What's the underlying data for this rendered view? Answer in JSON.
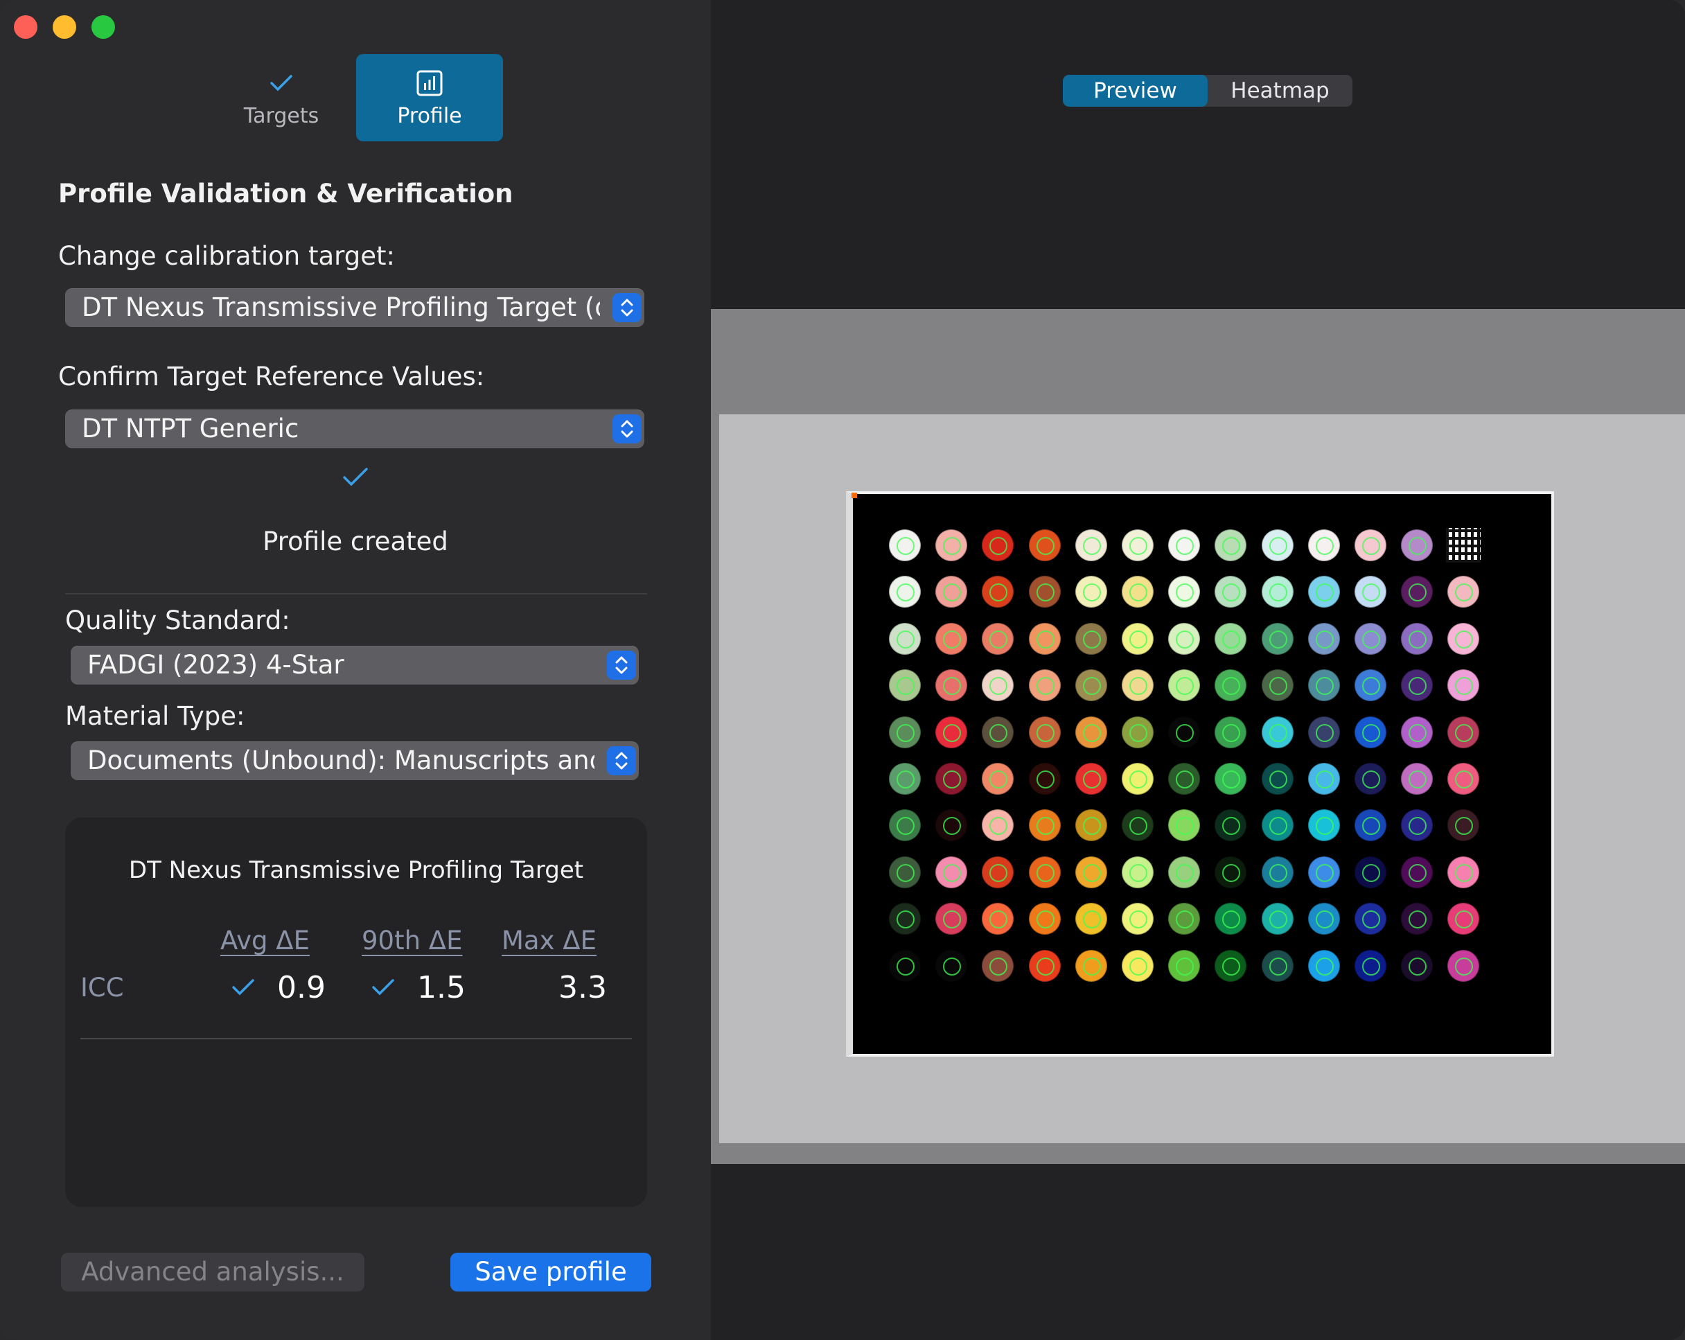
{
  "tabs": [
    {
      "label": "Targets",
      "icon": "checkmark-icon",
      "active": false
    },
    {
      "label": "Profile",
      "icon": "chart-icon",
      "active": true
    }
  ],
  "heading": "Profile Validation & Verification",
  "calibration_target": {
    "label": "Change calibration target:",
    "value": "DT Nexus Transmissive Profiling Target (de"
  },
  "reference_values": {
    "label": "Confirm Target Reference Values:",
    "value": "DT NTPT Generic"
  },
  "status": "Profile created",
  "quality_standard": {
    "label": "Quality Standard:",
    "value": "FADGI (2023) 4-Star"
  },
  "material_type": {
    "label": "Material Type:",
    "value": "Documents (Unbound): Manuscripts and"
  },
  "results": {
    "title": "DT Nexus Transmissive Profiling Target",
    "columns": [
      "Avg ΔE",
      "90th ΔE",
      "Max ΔE"
    ],
    "row_label": "ICC",
    "avg": "0.9",
    "p90": "1.5",
    "max": "3.3"
  },
  "buttons": {
    "advanced": "Advanced analysis...",
    "save": "Save profile"
  },
  "view_toggle": {
    "options": [
      "Preview",
      "Heatmap"
    ],
    "selected": "Preview"
  },
  "colors": {
    "accent": "#0e6a98",
    "primary_button": "#1a73e8",
    "check": "#3aa0e8"
  },
  "target_patch_colors": [
    [
      "#f2f2f0",
      "#f2b0a8",
      "#d8281c",
      "#e0501c",
      "#f2ead8",
      "#f2f0d8",
      "#f4f4f0",
      "#b8dcb4",
      "#d8eef0",
      "#f6f0f0",
      "#f6c8d0",
      "#b48ac8"
    ],
    [
      "#eef4ec",
      "#f0a098",
      "#d8401c",
      "#a0502c",
      "#f2f0b8",
      "#f2e08c",
      "#eef8e4",
      "#b8e0c0",
      "#b4ecd8",
      "#7cd0ec",
      "#c4dcf4",
      "#5a1e60",
      "#f4b8c0"
    ],
    [
      "#cee0c8",
      "#f07c68",
      "#e87c64",
      "#f09460",
      "#8c7848",
      "#f0f088",
      "#d8f0c0",
      "#98d898",
      "#4c9c78",
      "#7898c8",
      "#8c8cd0",
      "#8c6cc0",
      "#f8b4d4"
    ],
    [
      "#a8c890",
      "#e8706c",
      "#f0d4c8",
      "#f0a07c",
      "#9c8c50",
      "#f0d890",
      "#c0ec98",
      "#48b058",
      "#4c6848",
      "#4c8c9c",
      "#3c7cd8",
      "#4a2878",
      "#f0a0d8"
    ],
    [
      "#5c8c5c",
      "#e82c3c",
      "#5c503c",
      "#c8643c",
      "#e8943c",
      "#8ca040",
      "#080808",
      "#38a050",
      "#38c8d8",
      "#38406c",
      "#1858d0",
      "#b060c8",
      "#b83c5c"
    ],
    [
      "#5c9c6c",
      "#8c1830",
      "#f08868",
      "#2c0c08",
      "#e83030",
      "#f0f070",
      "#2c5c2c",
      "#38b858",
      "#0c4c4c",
      "#48b8e8",
      "#1c1c58",
      "#c06cc0",
      "#f05c80"
    ],
    [
      "#3c7c48",
      "#1c0808",
      "#f8b4a8",
      "#e87c1c",
      "#c8941c",
      "#1c3c1c",
      "#88d860",
      "#0c2c1c",
      "#0c8c8c",
      "#18c0d8",
      "#1848b8",
      "#28288c",
      "#3c1c24"
    ],
    [
      "#3c5c3c",
      "#f48cb0",
      "#d83c1c",
      "#e8641c",
      "#f0a82c",
      "#c8f08c",
      "#98d080",
      "#0c1c0c",
      "#1c7c9c",
      "#3c8ce8",
      "#0c0c48",
      "#500c58",
      "#f880b0"
    ],
    [
      "#1c2c1c",
      "#d83c5c",
      "#f8683c",
      "#f07818",
      "#f0c028",
      "#f0f07c",
      "#5c9c3c",
      "#0c8c48",
      "#1cb0a8",
      "#1c8cc8",
      "#1c2c9c",
      "#2c0c38",
      "#e83c78"
    ],
    [
      "#080808",
      "#080808",
      "#8c4c3c",
      "#e83c1c",
      "#f09c1c",
      "#f8e860",
      "#60c03c",
      "#0c5c1c",
      "#1c4c4c",
      "#1ca0e8",
      "#0c1c8c",
      "#1c0c2c",
      "#c83c9c"
    ]
  ]
}
